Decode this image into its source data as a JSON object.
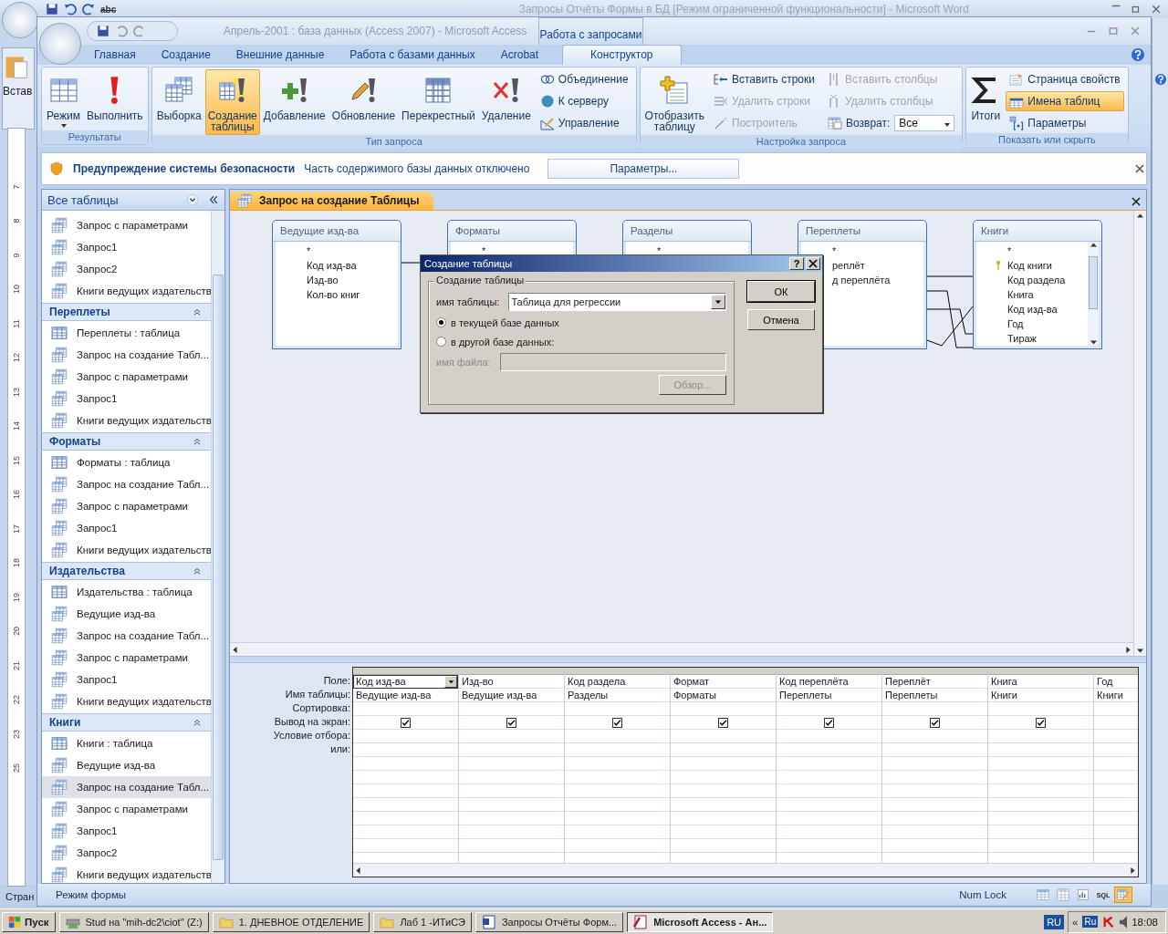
{
  "word": {
    "title": "Запросы Отчёты Формы в БД [Режим ограниченной функциональности] - Microsoft Word",
    "spell_label": "abc",
    "paste_label": "Встав",
    "status": "Стран",
    "ruler": [
      {
        "label": "7"
      },
      {
        "label": "8"
      },
      {
        "label": "9"
      },
      {
        "label": "10"
      },
      {
        "label": "11"
      },
      {
        "label": "12"
      },
      {
        "label": "13"
      },
      {
        "label": "14"
      },
      {
        "label": "15"
      },
      {
        "label": "16"
      },
      {
        "label": "17"
      },
      {
        "label": "18"
      },
      {
        "label": "19"
      },
      {
        "label": "20"
      },
      {
        "label": "21"
      },
      {
        "label": "22"
      },
      {
        "label": "23"
      },
      {
        "label": "25"
      }
    ]
  },
  "access": {
    "title": "Апрель-2001 : база данных (Access 2007) - Microsoft Access",
    "context_tab": "Работа с запросами",
    "tabs": [
      {
        "label": "Главная",
        "selected": false
      },
      {
        "label": "Создание",
        "selected": false
      },
      {
        "label": "Внешние данные",
        "selected": false
      },
      {
        "label": "Работа с базами данных",
        "selected": false
      },
      {
        "label": "Acrobat",
        "selected": false
      },
      {
        "label": "Конструктор",
        "selected": true
      }
    ],
    "ribbon": [
      {
        "label": "Результаты",
        "items": [
          {
            "kind": "big",
            "label": "Режим",
            "dropdown": true,
            "selected": false,
            "disabled": false
          },
          {
            "kind": "big",
            "label": "Выполнить",
            "selected": false,
            "disabled": false
          }
        ]
      },
      {
        "label": "Тип запроса",
        "items": [
          {
            "kind": "big",
            "label": "Выборка",
            "selected": false,
            "disabled": false
          },
          {
            "kind": "big",
            "label": "Создание\nтаблицы",
            "selected": true,
            "disabled": false
          },
          {
            "kind": "big",
            "label": "Добавление",
            "selected": false,
            "disabled": false
          },
          {
            "kind": "big",
            "label": "Обновление",
            "selected": false,
            "disabled": false
          },
          {
            "kind": "big",
            "label": "Перекрестный",
            "selected": false,
            "disabled": false
          },
          {
            "kind": "big",
            "label": "Удаление",
            "selected": false,
            "disabled": false
          },
          {
            "kind": "small",
            "label": "Объединение",
            "selected": false,
            "disabled": false
          },
          {
            "kind": "small",
            "label": "К серверу",
            "selected": false,
            "disabled": false
          },
          {
            "kind": "small",
            "label": "Управление",
            "selected": false,
            "disabled": false
          }
        ]
      },
      {
        "label": "Настройка запроса",
        "items": [
          {
            "kind": "big",
            "label": "Отобразить\nтаблицу",
            "selected": false,
            "disabled": false
          },
          {
            "kind": "small",
            "label": "Вставить строки",
            "selected": false,
            "disabled": false
          },
          {
            "kind": "small",
            "label": "Удалить строки",
            "selected": false,
            "disabled": true
          },
          {
            "kind": "small",
            "label": "Построитель",
            "selected": false,
            "disabled": true
          },
          {
            "kind": "small",
            "label": "Вставить столбцы",
            "selected": false,
            "disabled": true
          },
          {
            "kind": "small",
            "label": "Удалить столбцы",
            "selected": false,
            "disabled": true
          },
          {
            "kind": "combo",
            "label": "Возврат:",
            "value": "Все",
            "selected": false,
            "disabled": false
          }
        ]
      },
      {
        "label": "Показать или скрыть",
        "items": [
          {
            "kind": "big",
            "label": "Итоги",
            "selected": false,
            "disabled": false
          },
          {
            "kind": "small",
            "label": "Страница свойств",
            "selected": false,
            "disabled": false
          },
          {
            "kind": "small",
            "label": "Имена таблиц",
            "selected": true,
            "disabled": false
          },
          {
            "kind": "small",
            "label": "Параметры",
            "selected": false,
            "disabled": false
          }
        ]
      }
    ],
    "security_bar": {
      "title": "Предупреждение системы безопасности",
      "message": "Часть содержимого базы данных отключено",
      "button": "Параметры..."
    },
    "nav": {
      "title": "Все таблицы",
      "groups": [
        {
          "items": [
            {
              "kind": "query",
              "label": "Запрос с параметрами",
              "selected": false
            },
            {
              "kind": "query",
              "label": "Запрос1",
              "selected": false
            },
            {
              "kind": "query",
              "label": "Запрос2",
              "selected": false
            },
            {
              "kind": "query",
              "label": "Книги ведущих издательств",
              "selected": false
            }
          ]
        },
        {
          "title": "Переплеты",
          "items": [
            {
              "kind": "table",
              "label": "Переплеты : таблица",
              "selected": false
            },
            {
              "kind": "query",
              "label": "Запрос на создание Табл...",
              "selected": false
            },
            {
              "kind": "query",
              "label": "Запрос с параметрами",
              "selected": false
            },
            {
              "kind": "query",
              "label": "Запрос1",
              "selected": false
            },
            {
              "kind": "query",
              "label": "Книги ведущих издательств",
              "selected": false
            }
          ]
        },
        {
          "title": "Форматы",
          "items": [
            {
              "kind": "table",
              "label": "Форматы : таблица",
              "selected": false
            },
            {
              "kind": "query",
              "label": "Запрос на создание Табл...",
              "selected": false
            },
            {
              "kind": "query",
              "label": "Запрос с параметрами",
              "selected": false
            },
            {
              "kind": "query",
              "label": "Запрос1",
              "selected": false
            },
            {
              "kind": "query",
              "label": "Книги ведущих издательств",
              "selected": false
            }
          ]
        },
        {
          "title": "Издательства",
          "items": [
            {
              "kind": "table",
              "label": "Издательства : таблица",
              "selected": false
            },
            {
              "kind": "query",
              "label": "Ведущие изд-ва",
              "selected": false
            },
            {
              "kind": "query",
              "label": "Запрос на создание Табл...",
              "selected": false
            },
            {
              "kind": "query",
              "label": "Запрос с параметрами",
              "selected": false
            },
            {
              "kind": "query",
              "label": "Запрос1",
              "selected": false
            },
            {
              "kind": "query",
              "label": "Книги ведущих издательств",
              "selected": false
            }
          ]
        },
        {
          "title": "Книги",
          "items": [
            {
              "kind": "table",
              "label": "Книги : таблица",
              "selected": false
            },
            {
              "kind": "query",
              "label": "Ведущие изд-ва",
              "selected": false
            },
            {
              "kind": "query",
              "label": "Запрос на создание Табл...",
              "selected": true
            },
            {
              "kind": "query",
              "label": "Запрос с параметрами",
              "selected": false
            },
            {
              "kind": "query",
              "label": "Запрос1",
              "selected": false
            },
            {
              "kind": "query",
              "label": "Запрос2",
              "selected": false
            },
            {
              "kind": "query",
              "label": "Книги ведущих издательств",
              "selected": false
            }
          ]
        }
      ]
    },
    "document_tab": "Запрос на создание Таблицы",
    "tables": [
      {
        "name": "Ведущие изд-ва",
        "fields": [
          {
            "label": "*",
            "key": false
          },
          {
            "label": "Код изд-ва",
            "key": false
          },
          {
            "label": "Изд-во",
            "key": false
          },
          {
            "label": "Кол-во книг",
            "key": false
          }
        ]
      },
      {
        "name": "Форматы",
        "fields": [
          {
            "label": "*",
            "key": false
          }
        ]
      },
      {
        "name": "Разделы",
        "fields": [
          {
            "label": "*",
            "key": false
          }
        ]
      },
      {
        "name": "Переплеты",
        "fields": [
          {
            "label": "*",
            "key": false
          },
          {
            "label": "реплёт",
            "key": false
          },
          {
            "label": "д переплёта",
            "key": false
          }
        ]
      },
      {
        "name": "Книги",
        "scrollable": true,
        "fields": [
          {
            "label": "*",
            "key": false
          },
          {
            "label": "Код книги",
            "key": true
          },
          {
            "label": "Код раздела",
            "key": false
          },
          {
            "label": "Книга",
            "key": false
          },
          {
            "label": "Код изд-ва",
            "key": false
          },
          {
            "label": "Год",
            "key": false
          },
          {
            "label": "Тираж",
            "key": false
          }
        ]
      }
    ],
    "grid": {
      "row_labels": [
        "Поле:",
        "Имя таблицы:",
        "Сортировка:",
        "Вывод на экран:",
        "Условие отбора:",
        "или:"
      ],
      "columns": [
        {
          "field": "Код изд-ва",
          "table": "Ведущие изд-ва",
          "show": true,
          "selected": true
        },
        {
          "field": "Изд-во",
          "table": "Ведущие изд-ва",
          "show": true,
          "selected": false
        },
        {
          "field": "Код раздела",
          "table": "Разделы",
          "show": true,
          "selected": false
        },
        {
          "field": "Формат",
          "table": "Форматы",
          "show": true,
          "selected": false
        },
        {
          "field": "Код переплёта",
          "table": "Переплеты",
          "show": true,
          "selected": false
        },
        {
          "field": "Переплёт",
          "table": "Переплеты",
          "show": true,
          "selected": false
        },
        {
          "field": "Книга",
          "table": "Книги",
          "show": true,
          "selected": false
        },
        {
          "field": "Год",
          "table": "Книги",
          "selected": false
        }
      ]
    },
    "dialog": {
      "title": "Создание таблицы",
      "help": "?",
      "group": "Создание таблицы",
      "name_label": "имя таблицы:",
      "name_value": "Таблица для регрессии",
      "options": [
        {
          "label": "в текущей базе данных",
          "selected": true
        },
        {
          "label": "в другой базе данных:",
          "selected": false
        }
      ],
      "file_label": "имя файла:",
      "file_disabled": true,
      "browse": "Обзор...",
      "ok": "ОК",
      "cancel": "Отмена"
    },
    "status_bar": {
      "mode": "Режим формы",
      "num_lock": "Num Lock",
      "views": [
        {
          "kind": "datasheet",
          "selected": false
        },
        {
          "kind": "pivot",
          "selected": false
        },
        {
          "kind": "chart",
          "selected": false
        },
        {
          "kind": "sql",
          "label": "SQL",
          "selected": false
        },
        {
          "kind": "design",
          "selected": true
        }
      ]
    }
  },
  "taskbar": {
    "start": "Пуск",
    "buttons": [
      {
        "kind": "drive",
        "label": "Stud на \"mih-dc2\\ciot\" (Z:)",
        "selected": false
      },
      {
        "kind": "folder",
        "label": "1. ДНЕВНОЕ ОТДЕЛЕНИЕ",
        "selected": false
      },
      {
        "kind": "folder",
        "label": "Лаб 1 -ИТиСЭ",
        "selected": false
      },
      {
        "kind": "word",
        "label": "Запросы Отчёты Форм...",
        "selected": false
      },
      {
        "kind": "access",
        "label": "Microsoft Access - Ан...",
        "selected": true
      }
    ],
    "language": "RU",
    "chevron": "«",
    "input": "Ru",
    "clock": "18:08"
  }
}
